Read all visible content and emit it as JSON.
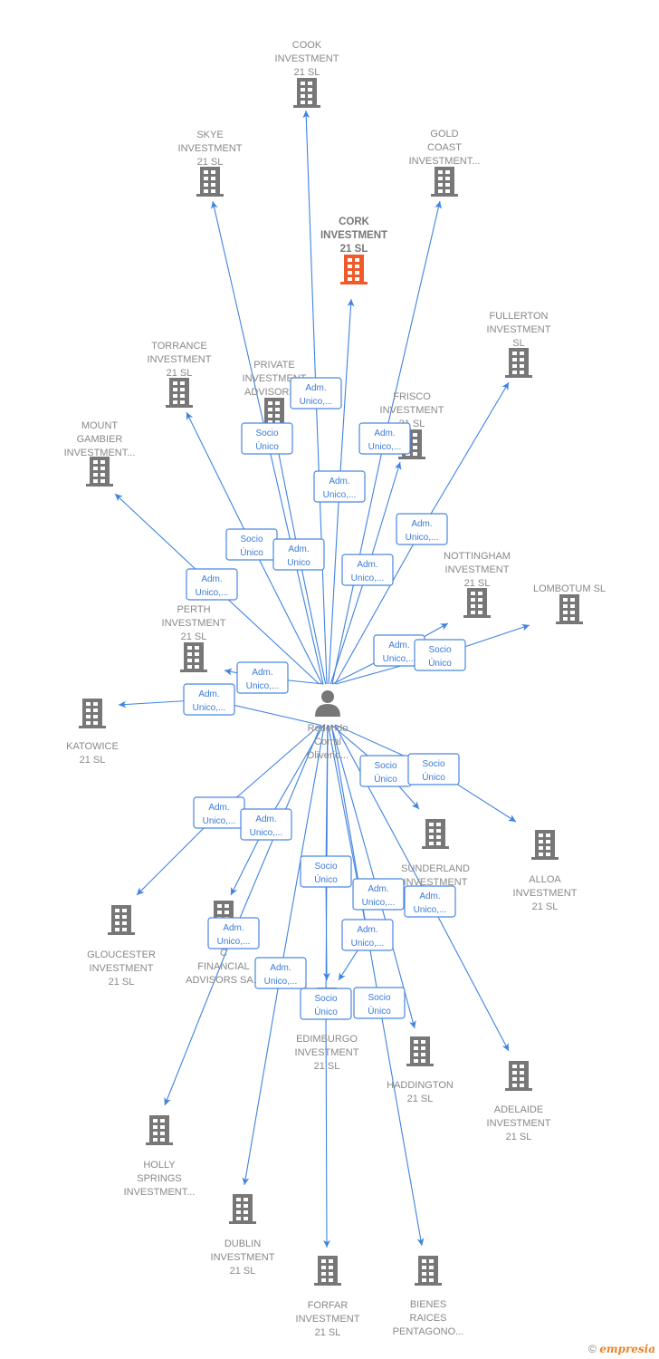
{
  "colors": {
    "edge": "#3f83e0",
    "company_icon": "#777777",
    "focus_icon": "#f05a28",
    "person_icon": "#777777"
  },
  "center": {
    "icon": "person-icon",
    "label": [
      "Redondo",
      "Corral",
      "Oliverio..."
    ]
  },
  "nodes": {
    "cook": {
      "label": [
        "COOK",
        "INVESTMENT",
        "21  SL"
      ]
    },
    "skye": {
      "label": [
        "SKYE",
        "INVESTMENT",
        "21  SL"
      ]
    },
    "gold": {
      "label": [
        "GOLD",
        "COAST",
        "INVESTMENT..."
      ]
    },
    "cork": {
      "label": [
        "CORK",
        "INVESTMENT",
        "21  SL"
      ],
      "highlight": true
    },
    "fullerton": {
      "label": [
        "FULLERTON",
        "INVESTMENT",
        "SL"
      ]
    },
    "torrance": {
      "label": [
        "TORRANCE",
        "INVESTMENT",
        "21  SL"
      ]
    },
    "private": {
      "label": [
        "PRIVATE",
        "INVESTMENT",
        "ADVISORS..."
      ]
    },
    "frisco": {
      "label": [
        "FRISCO",
        "INVESTMENT",
        "21  SL"
      ]
    },
    "mount": {
      "label": [
        "MOUNT",
        "GAMBIER",
        "INVESTMENT..."
      ]
    },
    "nottingham": {
      "label": [
        "NOTTINGHAM",
        "INVESTMENT",
        "21  SL"
      ]
    },
    "lombotum": {
      "label": [
        "LOMBOTUM  SL"
      ]
    },
    "perth": {
      "label": [
        "PERTH",
        "INVESTMENT",
        "21  SL"
      ]
    },
    "katowice": {
      "label": [
        "KATOWICE",
        "21  SL"
      ]
    },
    "sunderland": {
      "label": [
        "SUNDERLAND",
        "INVESTMENT",
        "21  SL"
      ]
    },
    "alloa": {
      "label": [
        "ALLOA",
        "INVESTMENT",
        "21  SL"
      ]
    },
    "gloucester": {
      "label": [
        "GLOUCESTER",
        "INVESTMENT",
        "21  SL"
      ]
    },
    "cfin": {
      "label": [
        "C",
        "FINANCIAL",
        "ADVISORS SA..."
      ]
    },
    "edimburgo": {
      "label": [
        "EDIMBURGO",
        "INVESTMENT",
        "21  SL"
      ]
    },
    "haddington": {
      "label": [
        "HADDINGTON",
        "21  SL"
      ]
    },
    "adelaide": {
      "label": [
        "ADELAIDE",
        "INVESTMENT",
        "21  SL"
      ]
    },
    "holly": {
      "label": [
        "HOLLY",
        "SPRINGS",
        "INVESTMENT..."
      ]
    },
    "dublin": {
      "label": [
        "DUBLIN",
        "INVESTMENT",
        "21  SL"
      ]
    },
    "forfar": {
      "label": [
        "FORFAR",
        "INVESTMENT",
        "21  SL"
      ]
    },
    "bienes": {
      "label": [
        "BIENES",
        "RAICES",
        "PENTAGONO..."
      ]
    }
  },
  "edges": [
    {
      "to": "cook",
      "label": [
        "Adm.",
        "Unico,..."
      ]
    },
    {
      "to": "skye",
      "label": [
        "Socio",
        "Único"
      ]
    },
    {
      "to": "gold",
      "label": [
        "Adm.",
        "Unico,..."
      ]
    },
    {
      "to": "cork",
      "label": [
        "Adm.",
        "Unico,..."
      ]
    },
    {
      "to": "fullerton",
      "label": [
        "Adm.",
        "Unico,..."
      ]
    },
    {
      "to": "torrance",
      "label": [
        "Socio",
        "Único"
      ]
    },
    {
      "to": "private",
      "label": [
        "Adm.",
        "Unico"
      ]
    },
    {
      "to": "frisco",
      "label": [
        "Adm.",
        "Unico,..."
      ]
    },
    {
      "to": "mount",
      "label": [
        "Adm.",
        "Unico,..."
      ]
    },
    {
      "to": "nottingham",
      "label": [
        "Adm.",
        "Unico,..."
      ]
    },
    {
      "to": "lombotum",
      "label": [
        "Socio",
        "Único"
      ]
    },
    {
      "to": "perth",
      "label": [
        "Adm.",
        "Unico,..."
      ]
    },
    {
      "to": "katowice",
      "label": [
        "Adm.",
        "Unico,..."
      ]
    },
    {
      "to": "sunderland",
      "label": [
        "Socio",
        "Único"
      ]
    },
    {
      "to": "alloa",
      "label": [
        "Socio",
        "Único"
      ]
    },
    {
      "to": "gloucester",
      "label": [
        "Adm.",
        "Unico,..."
      ]
    },
    {
      "to": "cfin",
      "label": [
        "Adm.",
        "Unico,..."
      ]
    },
    {
      "to": "edimburgo",
      "label": [
        "Socio",
        "Único"
      ]
    },
    {
      "to": "haddington",
      "label": [
        "Adm.",
        "Unico,..."
      ]
    },
    {
      "to": "adelaide",
      "label": [
        "Adm.",
        "Unico,..."
      ]
    },
    {
      "to": "edimburgo",
      "label": [
        "Adm.",
        "Unico,..."
      ]
    },
    {
      "to": "holly",
      "label": [
        "Adm.",
        "Unico,..."
      ]
    },
    {
      "to": "dublin",
      "label": [
        "Adm.",
        "Unico,..."
      ]
    },
    {
      "to": "forfar",
      "label": [
        "Socio",
        "Único"
      ]
    },
    {
      "to": "bienes",
      "label": [
        "Socio",
        "Único"
      ]
    }
  ],
  "watermark": {
    "symbol": "©",
    "brand": "empresia"
  }
}
